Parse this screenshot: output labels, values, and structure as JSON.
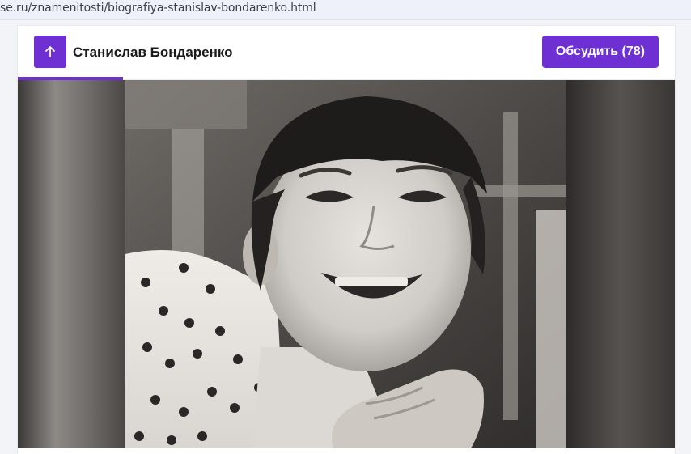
{
  "browser": {
    "url": "se.ru/znamenitosti/biografiya-stanislav-bondarenko.html"
  },
  "header": {
    "scroll_top_icon": "arrow-up-icon",
    "title": "Станислав Бондаренко",
    "discuss_label": "Обсудить (78)",
    "reading_progress_percent": 16
  },
  "photo": {
    "kind": "black-and-white childhood portrait"
  },
  "colors": {
    "accent": "#6e30d2"
  }
}
